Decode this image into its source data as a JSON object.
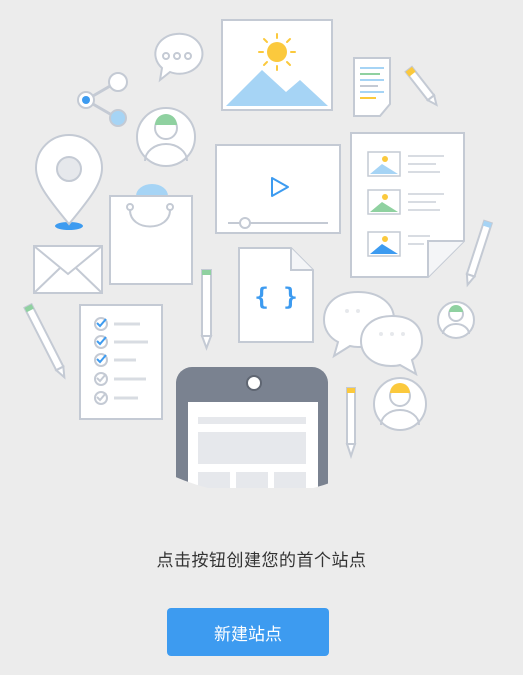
{
  "empty_state": {
    "prompt": "点击按钮创建您的首个站点",
    "create_button_label": "新建站点"
  },
  "colors": {
    "background": "#ececec",
    "accent": "#3d9bf0",
    "outline": "#c4cad4",
    "sun": "#fbc93d",
    "sky": "#a6d4f5",
    "green": "#8fd1a0"
  }
}
